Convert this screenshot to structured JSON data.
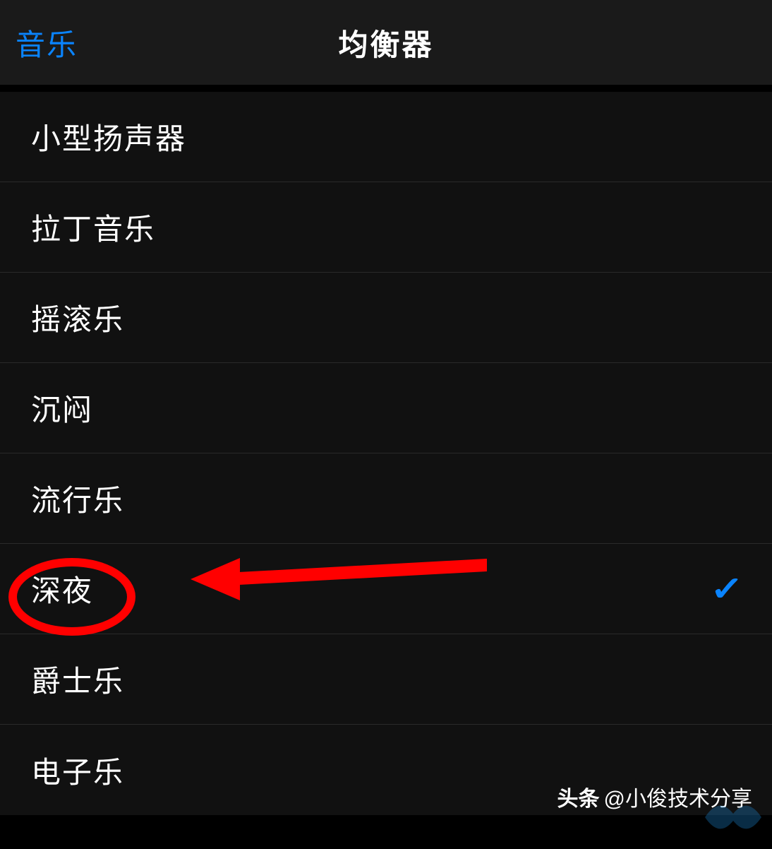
{
  "header": {
    "back_label": "音乐",
    "title": "均衡器"
  },
  "equalizer_options": [
    {
      "label": "小型扬声器",
      "selected": false,
      "name": "eq-small-speakers"
    },
    {
      "label": "拉丁音乐",
      "selected": false,
      "name": "eq-latin"
    },
    {
      "label": "摇滚乐",
      "selected": false,
      "name": "eq-rock"
    },
    {
      "label": "沉闷",
      "selected": false,
      "name": "eq-flat"
    },
    {
      "label": "流行乐",
      "selected": false,
      "name": "eq-pop"
    },
    {
      "label": "深夜",
      "selected": true,
      "name": "eq-late-night"
    },
    {
      "label": "爵士乐",
      "selected": false,
      "name": "eq-jazz"
    },
    {
      "label": "电子乐",
      "selected": false,
      "name": "eq-electronic"
    }
  ],
  "attribution": {
    "prefix": "头条",
    "handle": "@小俊技术分享"
  },
  "colors": {
    "accent": "#0a84ff",
    "annotation": "#ff0000"
  }
}
